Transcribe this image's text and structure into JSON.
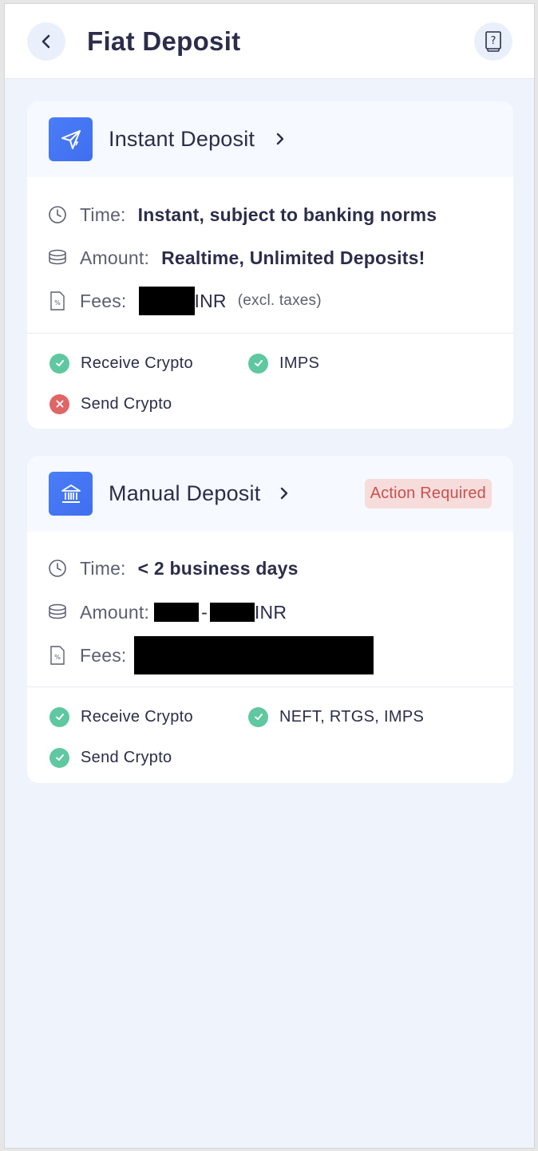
{
  "header": {
    "title": "Fiat Deposit",
    "back_icon": "chevron-left-icon",
    "help_icon": "help-book-icon"
  },
  "instant": {
    "title": "Instant Deposit",
    "icon": "send-lightning-icon",
    "time_label": "Time:",
    "time_value": "Instant, subject to banking norms",
    "amount_label": "Amount:",
    "amount_value": "Realtime, Unlimited Deposits!",
    "fees_label": "Fees:",
    "fees_currency": "INR",
    "fees_note": "(excl. taxes)",
    "features": [
      {
        "label": "Receive Crypto",
        "status": "ok"
      },
      {
        "label": "IMPS",
        "status": "ok"
      },
      {
        "label": "Send Crypto",
        "status": "no"
      }
    ]
  },
  "manual": {
    "title": "Manual Deposit",
    "icon": "bank-icon",
    "badge": "Action Required",
    "time_label": "Time:",
    "time_value": "< 2 business days",
    "amount_label": "Amount:",
    "amount_separator": "-",
    "amount_currency": "INR",
    "fees_label": "Fees:",
    "features": [
      {
        "label": "Receive Crypto",
        "status": "ok"
      },
      {
        "label": "NEFT, RTGS, IMPS",
        "status": "ok"
      },
      {
        "label": "Send Crypto",
        "status": "ok"
      }
    ]
  },
  "colors": {
    "accent": "#4a7df7",
    "success": "#5fc8a0",
    "error": "#e06565",
    "badge_bg": "#f7dcdc",
    "badge_text": "#c9514f",
    "page_bg": "#eef3fc"
  }
}
